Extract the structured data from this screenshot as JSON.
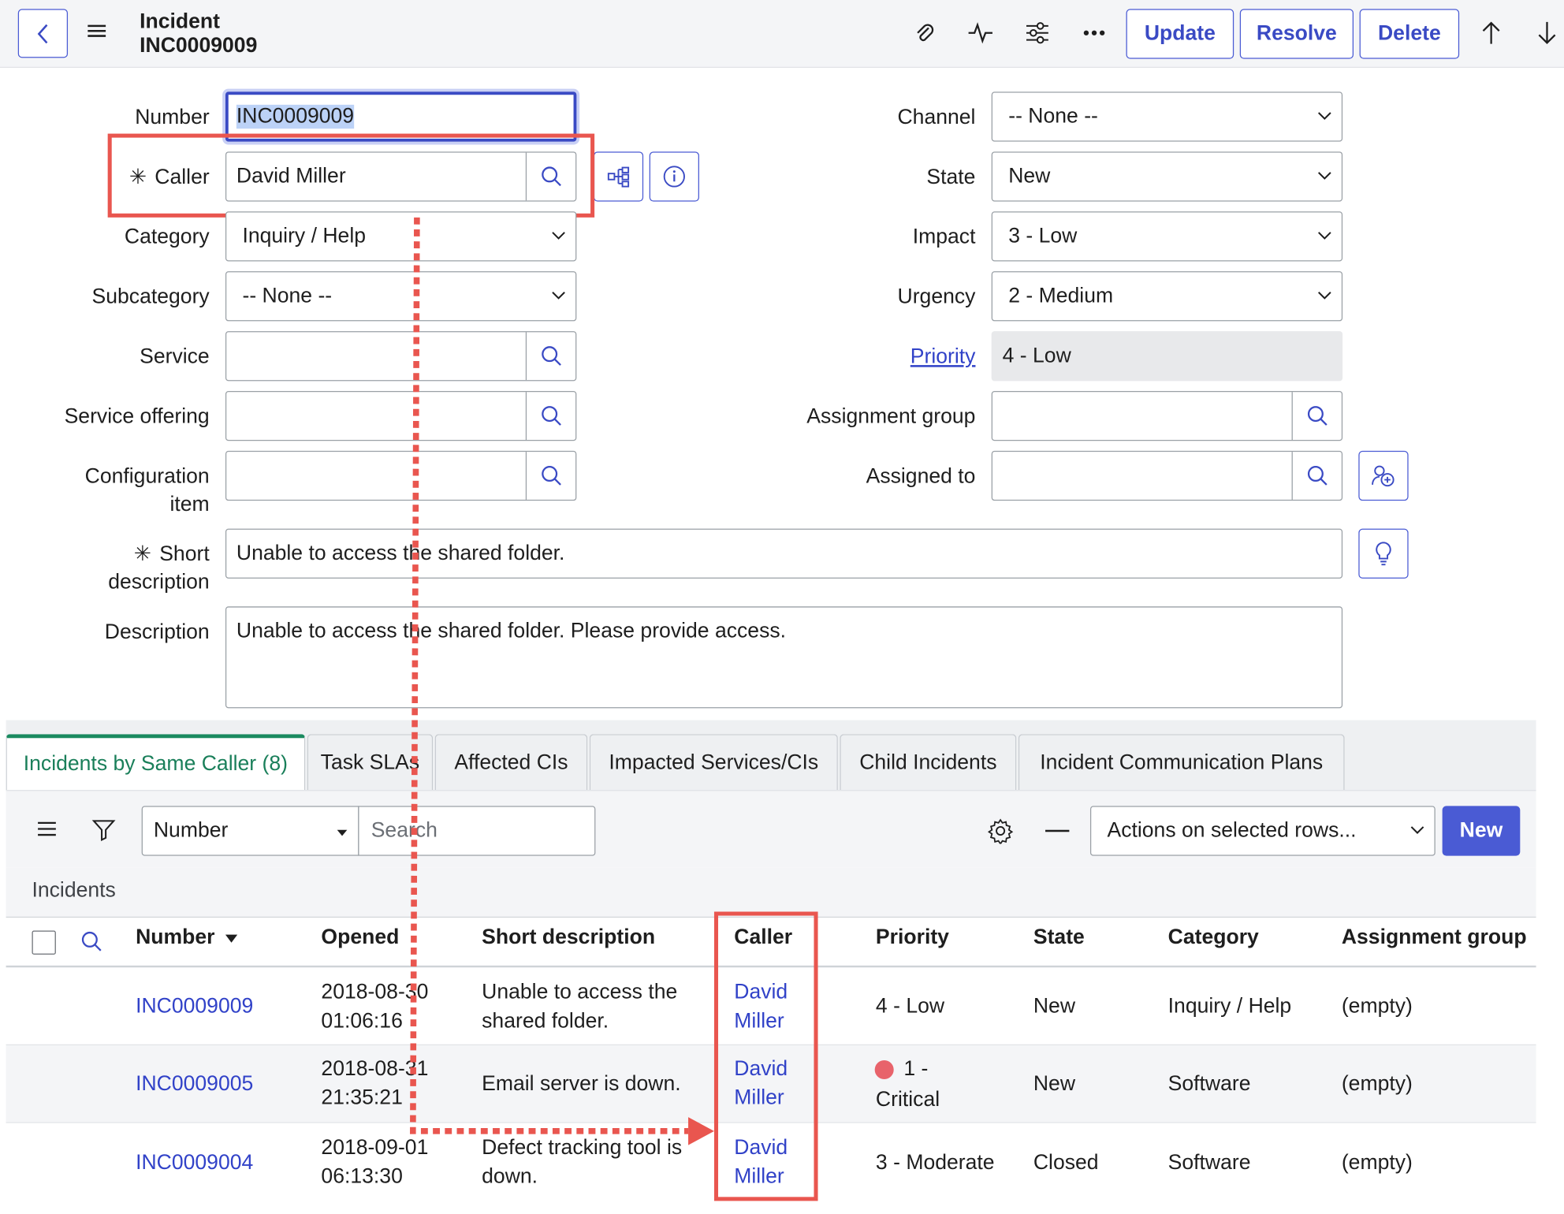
{
  "header": {
    "record_type": "Incident",
    "record_number": "INC0009009",
    "buttons": {
      "update": "Update",
      "resolve": "Resolve",
      "delete": "Delete"
    }
  },
  "form": {
    "left": {
      "number": {
        "label": "Number",
        "value": "INC0009009"
      },
      "caller": {
        "label": "Caller",
        "value": "David Miller",
        "required": true
      },
      "category": {
        "label": "Category",
        "value": "Inquiry / Help"
      },
      "subcategory": {
        "label": "Subcategory",
        "value": "-- None --"
      },
      "service": {
        "label": "Service",
        "value": ""
      },
      "service_offering": {
        "label": "Service offering",
        "value": ""
      },
      "config_item": {
        "label_line1": "Configuration",
        "label_line2": "item",
        "value": ""
      }
    },
    "right": {
      "channel": {
        "label": "Channel",
        "value": "-- None --"
      },
      "state": {
        "label": "State",
        "value": "New"
      },
      "impact": {
        "label": "Impact",
        "value": "3 - Low"
      },
      "urgency": {
        "label": "Urgency",
        "value": "2 - Medium"
      },
      "priority": {
        "label": "Priority",
        "value": "4 - Low"
      },
      "assignment_group": {
        "label": "Assignment group",
        "value": ""
      },
      "assigned_to": {
        "label": "Assigned to",
        "value": ""
      }
    },
    "short_description": {
      "label_line1": "Short",
      "label_line2": "description",
      "value": "Unable to access the shared folder.",
      "required": true
    },
    "description": {
      "label": "Description",
      "value": "Unable to access the shared folder. Please provide access."
    }
  },
  "tabs": [
    {
      "label": "Incidents by Same Caller (8)",
      "active": true
    },
    {
      "label": "Task SLAs"
    },
    {
      "label": "Affected CIs"
    },
    {
      "label": "Impacted Services/CIs"
    },
    {
      "label": "Child Incidents"
    },
    {
      "label": "Incident Communication Plans"
    }
  ],
  "list": {
    "search_field": "Number",
    "search_placeholder": "Search",
    "actions": "Actions on selected rows...",
    "new_button": "New",
    "title": "Incidents",
    "columns": [
      "Number",
      "Opened",
      "Short description",
      "Caller",
      "Priority",
      "State",
      "Category",
      "Assignment group"
    ],
    "rows": [
      {
        "number": "INC0009009",
        "opened_date": "2018-08-30",
        "opened_time": "01:06:16",
        "desc_line1": "Unable to access the",
        "desc_line2": "shared folder.",
        "caller_first": "David",
        "caller_last": "Miller",
        "priority_line1": "4 - Low",
        "priority_line2": "",
        "state": "New",
        "category": "Inquiry / Help",
        "group": "(empty)"
      },
      {
        "number": "INC0009005",
        "opened_date": "2018-08-31",
        "opened_time": "21:35:21",
        "desc_line1": "Email server is down.",
        "desc_line2": "",
        "caller_first": "David",
        "caller_last": "Miller",
        "priority_line1": "1 -",
        "priority_line2": "Critical",
        "state": "New",
        "category": "Software",
        "group": "(empty)"
      },
      {
        "number": "INC0009004",
        "opened_date": "2018-09-01",
        "opened_time": "06:13:30",
        "desc_line1": "Defect tracking tool is",
        "desc_line2": "down.",
        "caller_first": "David",
        "caller_last": "Miller",
        "priority_line1": "3 - Moderate",
        "priority_line2": "",
        "state": "Closed",
        "category": "Software",
        "group": "(empty)"
      }
    ]
  },
  "colors": {
    "accent": "#3a4ac4",
    "highlight": "#e9564f",
    "critical_dot": "#e8636b",
    "active_tab": "#1a8a5f"
  }
}
